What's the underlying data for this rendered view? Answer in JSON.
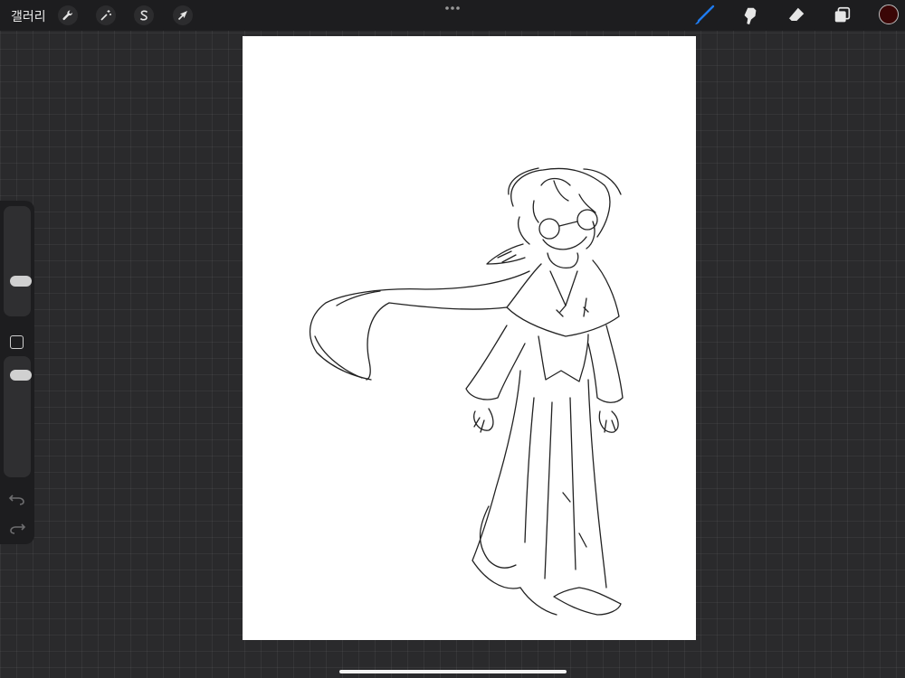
{
  "topbar": {
    "gallery_label": "갤러리",
    "left_tools": [
      {
        "name": "actions",
        "icon": "wrench-icon"
      },
      {
        "name": "adjustments",
        "icon": "magic-wand-icon"
      },
      {
        "name": "selection",
        "icon": "selection-s-icon"
      },
      {
        "name": "transform",
        "icon": "arrow-cursor-icon"
      }
    ],
    "more_icon": "ellipsis-icon",
    "right_tools": [
      {
        "name": "brush",
        "icon": "brush-icon",
        "active": true
      },
      {
        "name": "smudge",
        "icon": "smudge-icon",
        "active": false
      },
      {
        "name": "eraser",
        "icon": "eraser-icon",
        "active": false
      },
      {
        "name": "layers",
        "icon": "layers-icon",
        "active": false
      }
    ],
    "current_color": "#3a0606"
  },
  "sidebar": {
    "brush_size_level": 0.3,
    "opacity_level": 0.88,
    "modify_icon": "square-icon",
    "undo_icon": "undo-icon",
    "redo_icon": "redo-icon"
  },
  "colors": {
    "accent": "#1e7bf0",
    "background": "#2a2a2c",
    "toolbar": "#1d1d1f",
    "canvas": "#ffffff"
  }
}
